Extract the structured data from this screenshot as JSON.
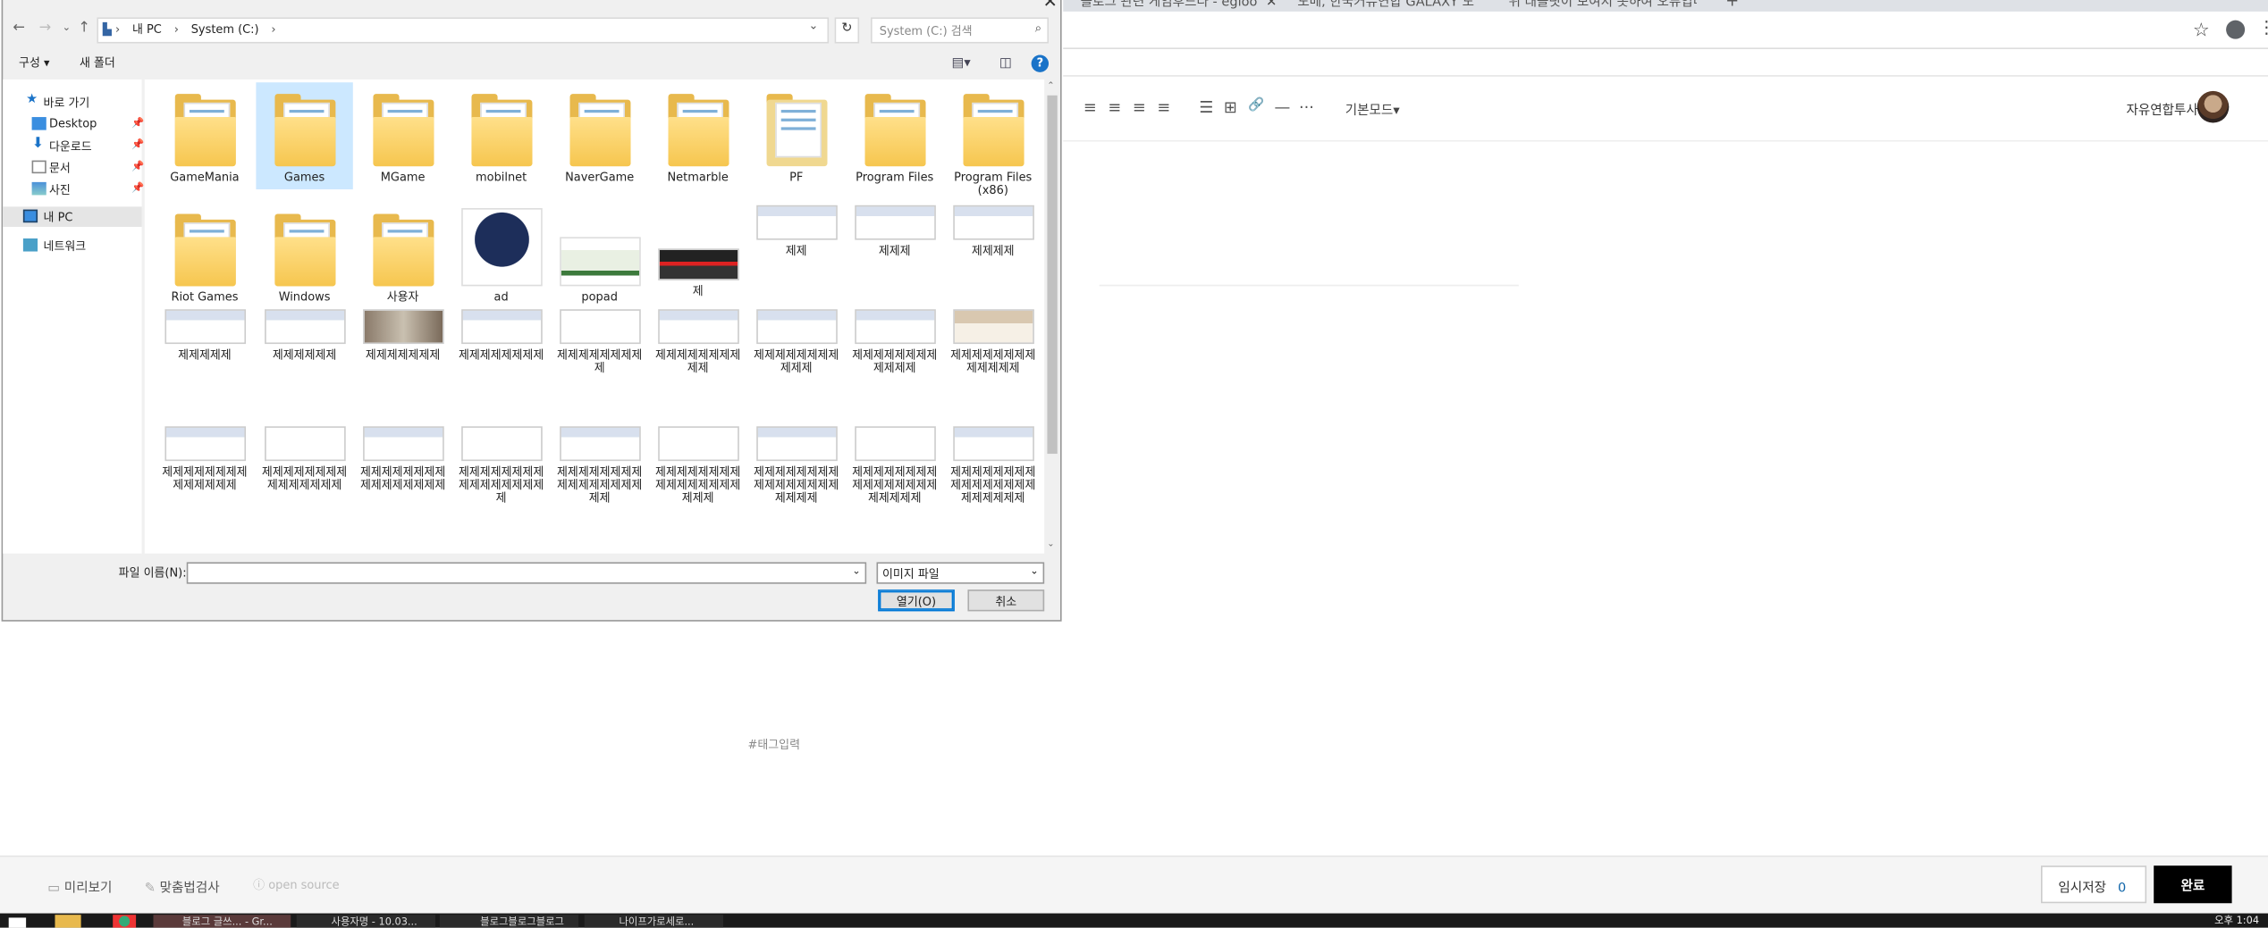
{
  "browser": {
    "tabs": [
      {
        "label": "블로그 관련 게임후드다 - egloo",
        "close": "✕"
      },
      {
        "label": "도메, 한국커뮤연합 GALAXY 도",
        "close": "✕"
      },
      {
        "label": "위 태블릿이 보여지 못하여 오류입니다...",
        "close": "✕"
      }
    ],
    "new_tab": "+",
    "star_icon": "☆",
    "menu_icon": "⋮"
  },
  "editor": {
    "toolbar_icons": [
      "≡",
      "≡",
      "≡",
      "≡",
      "☰",
      "⊞",
      "🔗",
      "—",
      "···"
    ],
    "mode": "기본모드▾",
    "user_name": "자유연합투사",
    "tag_placeholder": "#태그입력"
  },
  "footer": {
    "preview": "미리보기",
    "spellcheck": "맞춤법검사",
    "opensource": "open source",
    "save_label": "임시저장",
    "save_count": "0",
    "done_label": "완료"
  },
  "taskbar": {
    "apps": [
      "",
      "",
      "",
      "블로그 글쓰... - Gr...",
      "사용자명 - 10.03...",
      "블로그블로그블로그",
      "나이프가로세로..."
    ],
    "clock": "오후 1:04"
  },
  "dialog": {
    "close": "✕",
    "path": [
      "내 PC",
      "System (C:)"
    ],
    "search_placeholder": "System (C:) 검색",
    "organize": "구성 ▾",
    "new_folder": "새 폴더",
    "help": "?",
    "sidebar": [
      {
        "label": "바로 가기",
        "pin": false,
        "selected": false
      },
      {
        "label": "Desktop",
        "pin": true,
        "selected": false
      },
      {
        "label": "다운로드",
        "pin": true,
        "selected": false
      },
      {
        "label": "문서",
        "pin": true,
        "selected": false
      },
      {
        "label": "사진",
        "pin": true,
        "selected": false
      },
      {
        "label": "내 PC",
        "pin": false,
        "selected": true
      },
      {
        "label": "네트워크",
        "pin": false,
        "selected": false
      }
    ],
    "items_row1": [
      "GameMania",
      "Games",
      "MGame",
      "mobilnet",
      "NaverGame",
      "Netmarble",
      "PF",
      "Program Files",
      "Program Files (x86)"
    ],
    "items_row2": [
      "Riot Games",
      "Windows",
      "사용자",
      "ad",
      "popad",
      "제",
      "제제",
      "제제제",
      "제제제제"
    ],
    "items_row3": [
      "제제제제제",
      "제제제제제제",
      "제제제제제제제",
      "제제제제제제제제",
      "제제제제제제제제제",
      "제제제제제제제제제제",
      "제제제제제제제제제제제",
      "제제제제제제제제제제제제",
      "제제제제제제제제제제제제제"
    ],
    "items_row4": [
      "제제제제제제제제제제제제제제",
      "제제제제제제제제제제제제제제제",
      "제제제제제제제제제제제제제제제제",
      "제제제제제제제제제제제제제제제제제",
      "제제제제제제제제제제제제제제제제제제",
      "제제제제제제제제제제제제제제제제제제제",
      "제제제제제제제제제제제제제제제제제제제제",
      "제제제제제제제제제제제제제제제제제제제제제",
      "제제제제제제제제제제제제제제제제제제제제제제"
    ],
    "filename_label": "파일 이름(N):",
    "filename_value": "",
    "filetype": "이미지 파일",
    "open_label": "열기(O)",
    "cancel_label": "취소"
  }
}
